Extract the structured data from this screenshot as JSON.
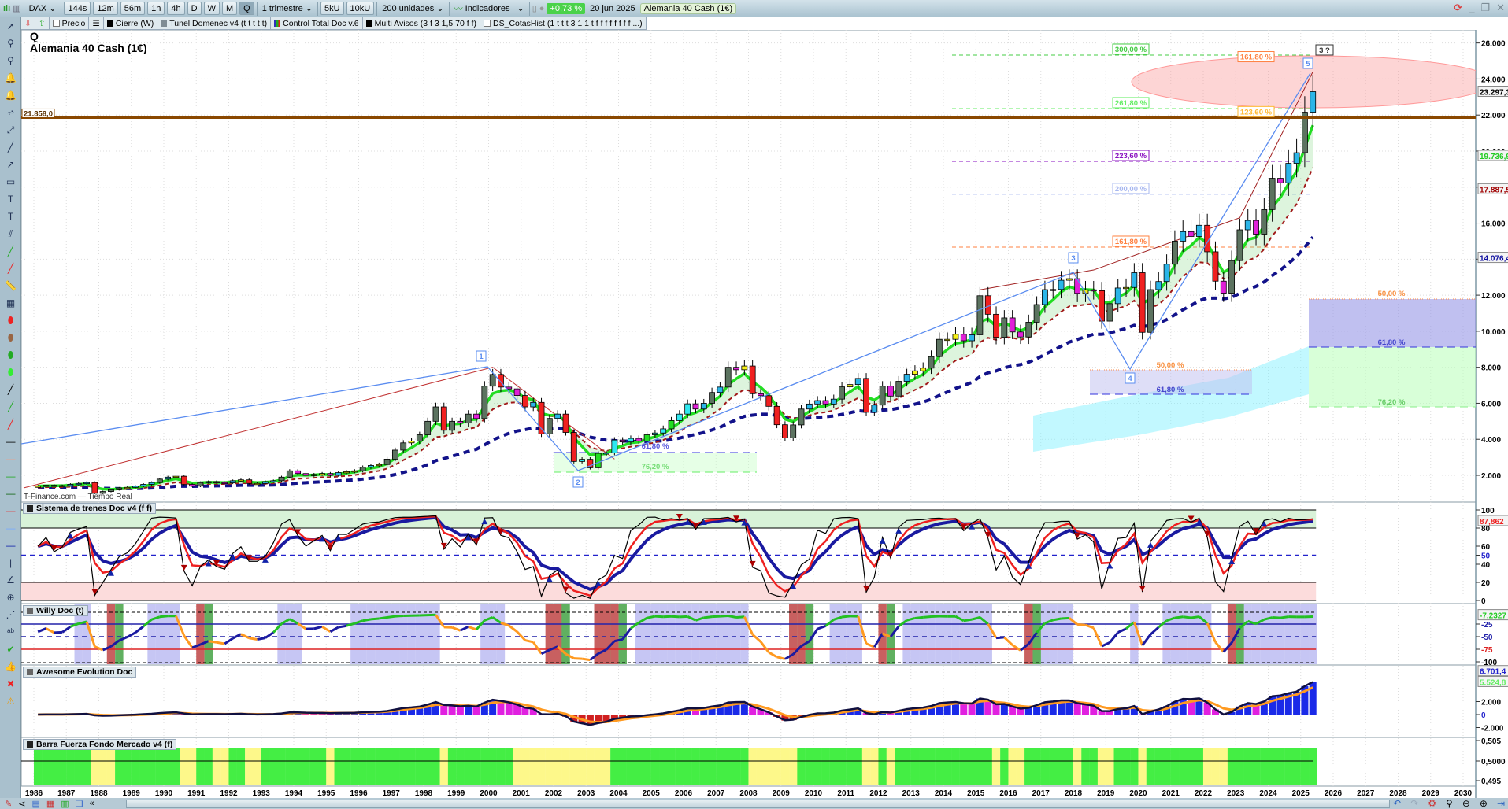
{
  "toolbar": {
    "symbol": "DAX",
    "timeframes": [
      "144s",
      "12m",
      "56m",
      "1h",
      "4h",
      "D",
      "W",
      "M",
      "Q"
    ],
    "active_timeframe": "Q",
    "period": "1 trimestre",
    "units": [
      "5kU",
      "10kU"
    ],
    "quantity": "200 unidades",
    "indicators": "Indicadores",
    "change": "+0,73 %",
    "date": "20 jun 2025",
    "instrument": "Alemania 40 Cash (1€)"
  },
  "legend": {
    "price": "Precio",
    "items": [
      {
        "label": "Cierre (W)",
        "color": "#000000"
      },
      {
        "label": "Tunel Domenec v4 (t t t t t)",
        "color": "#7f8c94"
      },
      {
        "label": "Control Total Doc v.6",
        "color": "#3030c0"
      },
      {
        "label": "Multi Avisos (3 f 3 1,5 70 f f)",
        "color": "#000000"
      }
    ],
    "hist": "DS_CotasHist (1 t t t 3 1 1 t f f f f f f f f ...)"
  },
  "sidebar_icons": [
    "pointer-icon",
    "zoom-icon",
    "zoom-area-icon",
    "alert-edit-icon",
    "alert-icon",
    "fibonacci-icon",
    "trend-icon",
    "color-line-icon",
    "arrow-icon",
    "rectangle-icon",
    "text-icon",
    "text-bold-icon",
    "channel-icon",
    "line-green-icon",
    "line-red-icon",
    "ruler-icon",
    "chart-template-icon",
    "ellipse-red-icon",
    "ellipse-brown-icon",
    "ellipse-green-icon",
    "ellipse-lime-icon",
    "line-black-icon",
    "line-green2-icon",
    "line-red2-icon",
    "hline-black-icon",
    "hline-salmon-icon",
    "hline-green-icon",
    "hline-darkgreen-icon",
    "hline-red-icon",
    "hline-lightblue-icon",
    "hline-navy-icon",
    "vline-icon",
    "angle-icon",
    "circle-icon",
    "elliott-icon",
    "abc-icon",
    "check-icon",
    "thumbs-up-icon",
    "cross-icon",
    "warning-icon"
  ],
  "main": {
    "period_letter": "Q",
    "title": "Alemania 40 Cash (1€)",
    "watermark": "T-Finance.com — Tiempo Real",
    "hline": {
      "price": 21858,
      "label": "21.858,0"
    },
    "price_ticks": [
      2000,
      4000,
      6000,
      8000,
      10000,
      12000,
      14000,
      16000,
      18000,
      20000,
      22000,
      24000,
      26000
    ],
    "price_tick_labels": [
      "2.000",
      "4.000",
      "6.000",
      "8.000",
      "10.000",
      "12.000",
      "14.000",
      "16.000",
      "18.000",
      "20.000",
      "22.000",
      "24.000",
      "26.000"
    ],
    "value_tags": [
      {
        "text": "23.297,3",
        "price": 23297,
        "color": "#000000"
      },
      {
        "text": "19.736,9",
        "price": 19737,
        "color": "#22cc22"
      },
      {
        "text": "17.887,5",
        "price": 17887,
        "color": "#a00000"
      },
      {
        "text": "14.076,4",
        "price": 14076,
        "color": "#1010a0"
      }
    ],
    "fib_levels": [
      {
        "label": "300,00 %",
        "price": 25330,
        "color": "#44cc44"
      },
      {
        "label": "261,80 %",
        "price": 22360,
        "color": "#66ee66"
      },
      {
        "label": "223,60 %",
        "price": 19430,
        "color": "#8a10c0"
      },
      {
        "label": "200,00 %",
        "price": 17600,
        "color": "#a8b8f0"
      },
      {
        "label": "161,80 %",
        "price": 14670,
        "color": "#ff8040"
      }
    ],
    "target_levels": [
      {
        "label": "161,80 %",
        "price": 25000,
        "color": "#ff8040"
      },
      {
        "label": "123,60 %",
        "price": 21950,
        "color": "#ffb830"
      }
    ],
    "wave_labels": [
      "1",
      "2",
      "3",
      "4",
      "5",
      "3 ?"
    ],
    "zone_2": {
      "top_label": "61,80 %",
      "bottom_label": "76,20 %"
    },
    "zone_4": {
      "top_label": "50,00 %",
      "bottom_label": "61,80 %"
    },
    "zone_right": {
      "top_label": "50,00 %",
      "mid_label": "61,80 %",
      "bottom_label": "76,20 %"
    }
  },
  "panes": {
    "trenes": {
      "title": "Sistema de trenes Doc v4 (f f)",
      "ticks": [
        "100",
        "80",
        "60",
        "50",
        "40",
        "20",
        "0"
      ],
      "tag": "87,862",
      "tag_value": 87.862
    },
    "willy": {
      "title": "Willy Doc (t)",
      "ticks": [
        "-25",
        "-50",
        "-75",
        "-100"
      ],
      "tag": "-7,2327",
      "tag_value": -7.2327
    },
    "awesome": {
      "title": "Awesome Evolution Doc",
      "ticks": [
        "2.000",
        "0",
        "-2.000"
      ],
      "tags": [
        "6.701,4",
        "5.524,8"
      ],
      "tag_values": [
        6701.4,
        5524.8
      ]
    },
    "barra": {
      "title": "Barra Fuerza Fondo Mercado v4 (f)",
      "ticks": [
        "0,505",
        "0,5000",
        "0,495"
      ]
    }
  },
  "years": [
    "1986",
    "1987",
    "1988",
    "1989",
    "1990",
    "1991",
    "1992",
    "1993",
    "1994",
    "1995",
    "1996",
    "1997",
    "1998",
    "1999",
    "2000",
    "2001",
    "2002",
    "2003",
    "2004",
    "2005",
    "2006",
    "2007",
    "2008",
    "2009",
    "2010",
    "2011",
    "2012",
    "2013",
    "2014",
    "2015",
    "2016",
    "2017",
    "2018",
    "2019",
    "2020",
    "2021",
    "2022",
    "2023",
    "2024",
    "2025",
    "2026",
    "2027",
    "2028",
    "2029",
    "2030"
  ],
  "chart_data": {
    "type": "candlestick",
    "interval": "quarter",
    "start": "1986 Q1",
    "closes": [
      1400,
      1450,
      1420,
      1430,
      1500,
      1550,
      1600,
      1000,
      1100,
      1200,
      1300,
      1330,
      1400,
      1500,
      1600,
      1790,
      1900,
      1950,
      1500,
      1400,
      1600,
      1650,
      1600,
      1580,
      1700,
      1750,
      1550,
      1550,
      1650,
      1700,
      1900,
      2250,
      2100,
      2000,
      2050,
      2100,
      2000,
      2150,
      2200,
      2250,
      2450,
      2550,
      2600,
      2900,
      3400,
      3800,
      3900,
      4250,
      5000,
      5800,
      4500,
      5000,
      4900,
      5400,
      5150,
      6950,
      7600,
      6900,
      6800,
      6430,
      5800,
      6050,
      4300,
      5160,
      5400,
      4380,
      2770,
      2890,
      2420,
      3220,
      3250,
      3960,
      3850,
      4050,
      3900,
      4250,
      4350,
      4580,
      5040,
      5400,
      5970,
      5680,
      6000,
      6600,
      6900,
      8000,
      7860,
      8070,
      6530,
      6420,
      5830,
      4810,
      4080,
      4800,
      5680,
      5960,
      6150,
      5960,
      6230,
      6910,
      7040,
      7380,
      5500,
      5900,
      6950,
      6400,
      7220,
      7610,
      7800,
      7950,
      8590,
      9550,
      9550,
      9830,
      9470,
      9800,
      11970,
      10940,
      9660,
      10740,
      9960,
      9680,
      10500,
      11480,
      12310,
      12320,
      12830,
      12920,
      12100,
      12300,
      12250,
      10560,
      11530,
      12400,
      12430,
      13250,
      9940,
      12310,
      12760,
      13720,
      15000,
      15530,
      15260,
      15880,
      14410,
      12780,
      12110,
      13920,
      15630,
      16150,
      15390,
      16750,
      18490,
      18240,
      19320,
      19910,
      22160,
      23297
    ]
  }
}
